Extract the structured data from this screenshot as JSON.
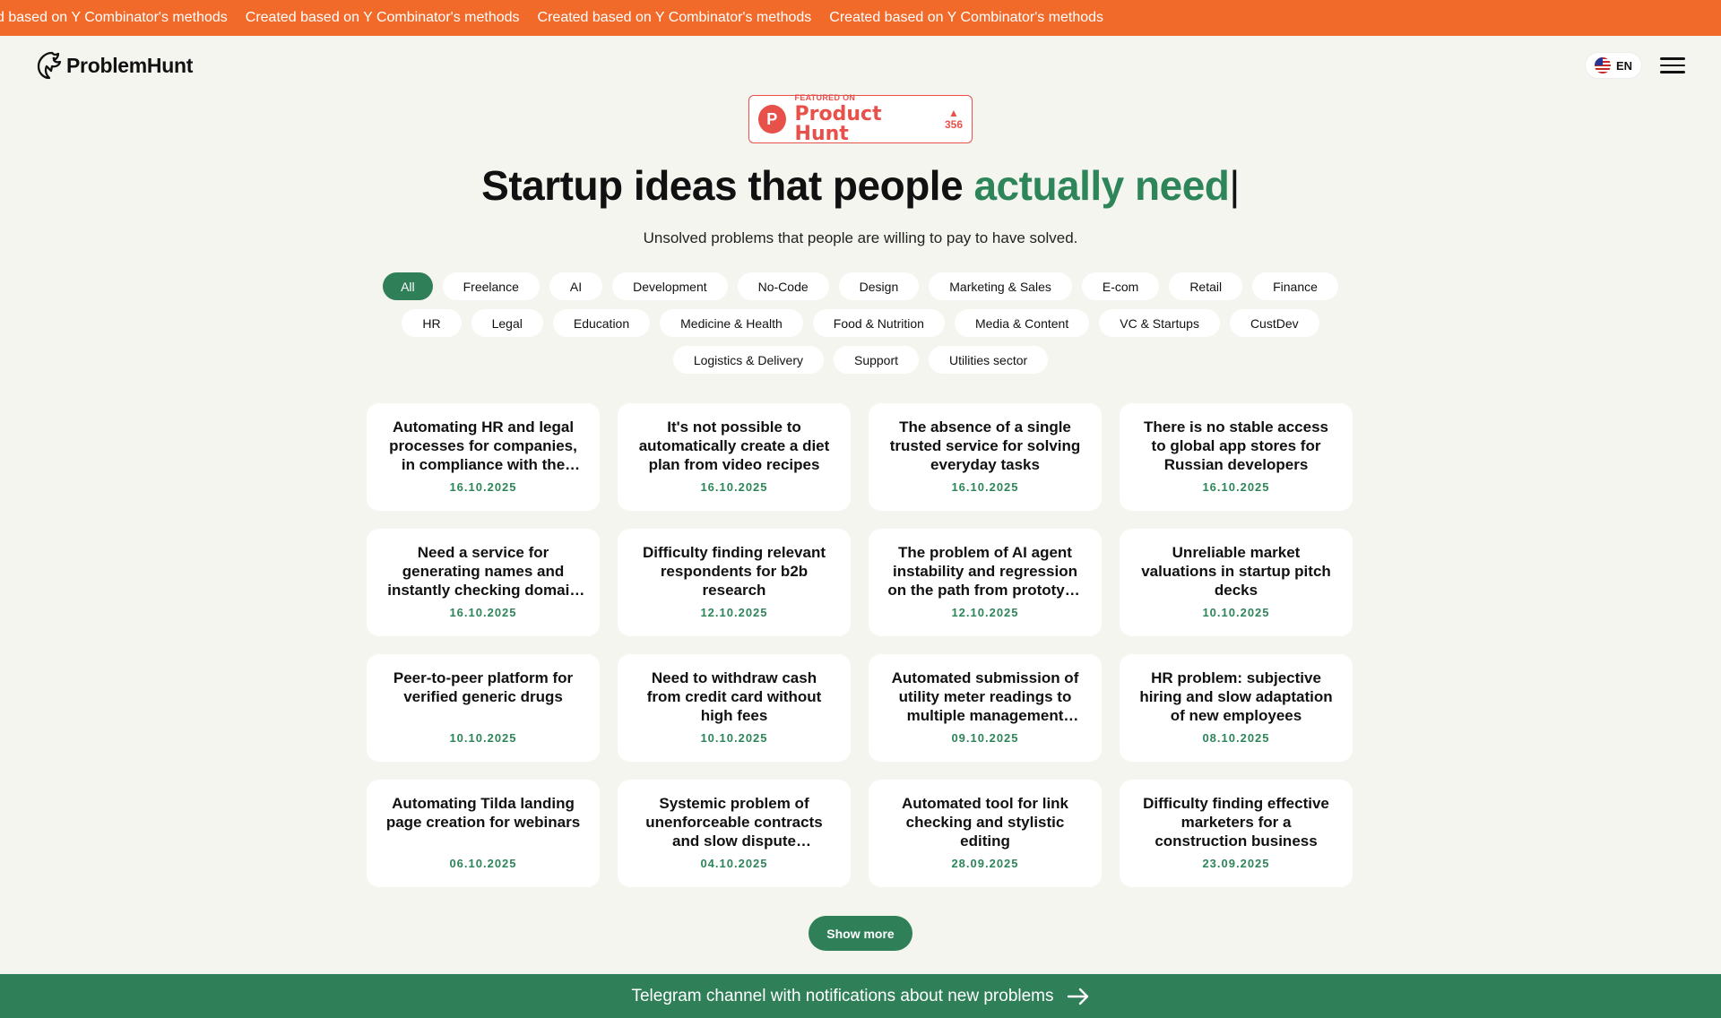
{
  "ticker": {
    "items": [
      "Created based on Y Combinator's methods",
      "Created based on Y Combinator's methods",
      "Created based on Y Combinator's methods",
      "Created based on Y Combinator's methods"
    ]
  },
  "header": {
    "logo_text": "ProblemHunt",
    "lang_label": "EN"
  },
  "product_hunt_badge": {
    "featured": "FEATURED ON",
    "name": "Product Hunt",
    "votes": "356",
    "logo_letter": "P"
  },
  "hero": {
    "title_main": "Startup ideas that people ",
    "title_accent": "actually need",
    "cursor": "|",
    "subtitle": "Unsolved problems that people are willing to pay to have solved."
  },
  "categories": [
    "All",
    "Freelance",
    "AI",
    "Development",
    "No-Code",
    "Design",
    "Marketing & Sales",
    "E-com",
    "Retail",
    "Finance",
    "HR",
    "Legal",
    "Education",
    "Medicine & Health",
    "Food & Nutrition",
    "Media & Content",
    "VC & Startups",
    "CustDev",
    "Logistics & Delivery",
    "Support",
    "Utilities sector"
  ],
  "active_category": "All",
  "problems": [
    {
      "title": "Automating HR and legal processes for companies, in compliance with the Labor Code",
      "date": "16.10.2025"
    },
    {
      "title": "It's not possible to automatically create a diet plan from video recipes",
      "date": "16.10.2025"
    },
    {
      "title": "The absence of a single trusted service for solving everyday tasks",
      "date": "16.10.2025"
    },
    {
      "title": "There is no stable access to global app stores for Russian developers",
      "date": "16.10.2025"
    },
    {
      "title": "Need a service for generating names and instantly checking domain availability",
      "date": "16.10.2025"
    },
    {
      "title": "Difficulty finding relevant respondents for b2b research",
      "date": "12.10.2025"
    },
    {
      "title": "The problem of AI agent instability and regression on the path from prototype to production",
      "date": "12.10.2025"
    },
    {
      "title": "Unreliable market valuations in startup pitch decks",
      "date": "10.10.2025"
    },
    {
      "title": "Peer-to-peer platform for verified generic drugs",
      "date": "10.10.2025"
    },
    {
      "title": "Need to withdraw cash from credit card without high fees",
      "date": "10.10.2025"
    },
    {
      "title": "Automated submission of utility meter readings to multiple management companies",
      "date": "09.10.2025"
    },
    {
      "title": "HR problem: subjective hiring and slow adaptation of new employees",
      "date": "08.10.2025"
    },
    {
      "title": "Automating Tilda landing page creation for webinars",
      "date": "06.10.2025"
    },
    {
      "title": "Systemic problem of unenforceable contracts and slow dispute resolution",
      "date": "04.10.2025"
    },
    {
      "title": "Automated tool for link checking and stylistic editing",
      "date": "28.09.2025"
    },
    {
      "title": "Difficulty finding effective marketers for a construction business",
      "date": "23.09.2025"
    }
  ],
  "show_more_label": "Show more",
  "footer": {
    "telegram_label": "Telegram channel with notifications about new problems"
  },
  "colors": {
    "ticker_bg": "#f26a2a",
    "accent_green": "#2f7f58",
    "page_bg": "#f5f5f0",
    "product_hunt": "#e8504a"
  }
}
